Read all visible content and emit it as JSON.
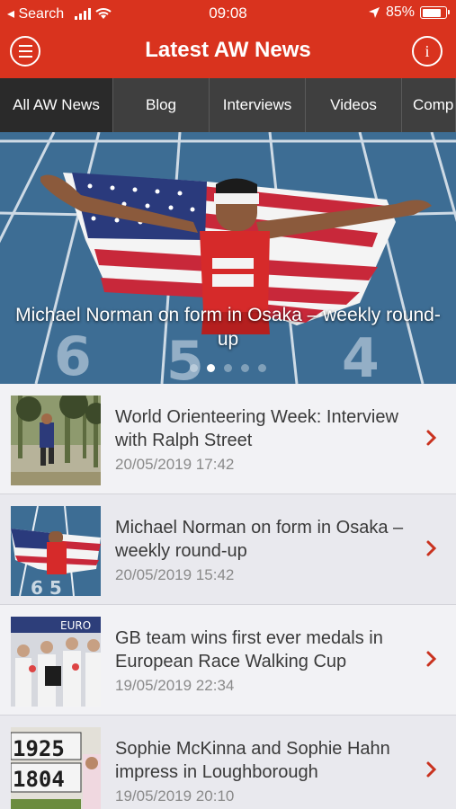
{
  "status_bar": {
    "back_label": "◂ Search",
    "time": "09:08",
    "battery_percent": "85%",
    "battery_level": 0.85
  },
  "header": {
    "title": "Latest AW News"
  },
  "tabs": [
    {
      "label": "All AW News",
      "active": true
    },
    {
      "label": "Blog",
      "active": false
    },
    {
      "label": "Interviews",
      "active": false
    },
    {
      "label": "Videos",
      "active": false
    },
    {
      "label": "Comp",
      "active": false
    }
  ],
  "hero": {
    "caption": "Michael Norman on form in Osaka – weekly round-up",
    "slide_count": 5,
    "active_slide": 1
  },
  "articles": [
    {
      "headline": "World Orienteering Week: Interview with Ralph Street",
      "date": "20/05/2019 17:42"
    },
    {
      "headline": "Michael Norman on form in Osaka – weekly round-up",
      "date": "20/05/2019 15:42"
    },
    {
      "headline": "GB team wins first ever medals in European Race Walking Cup",
      "date": "19/05/2019 22:34"
    },
    {
      "headline": "Sophie McKinna and Sophie Hahn impress in Loughborough",
      "date": "19/05/2019 20:10"
    }
  ],
  "colors": {
    "brand_red": "#d9331e",
    "tab_bar": "#3f3f3f",
    "tab_active": "#2a2a2a",
    "chevron": "#c9321f"
  }
}
